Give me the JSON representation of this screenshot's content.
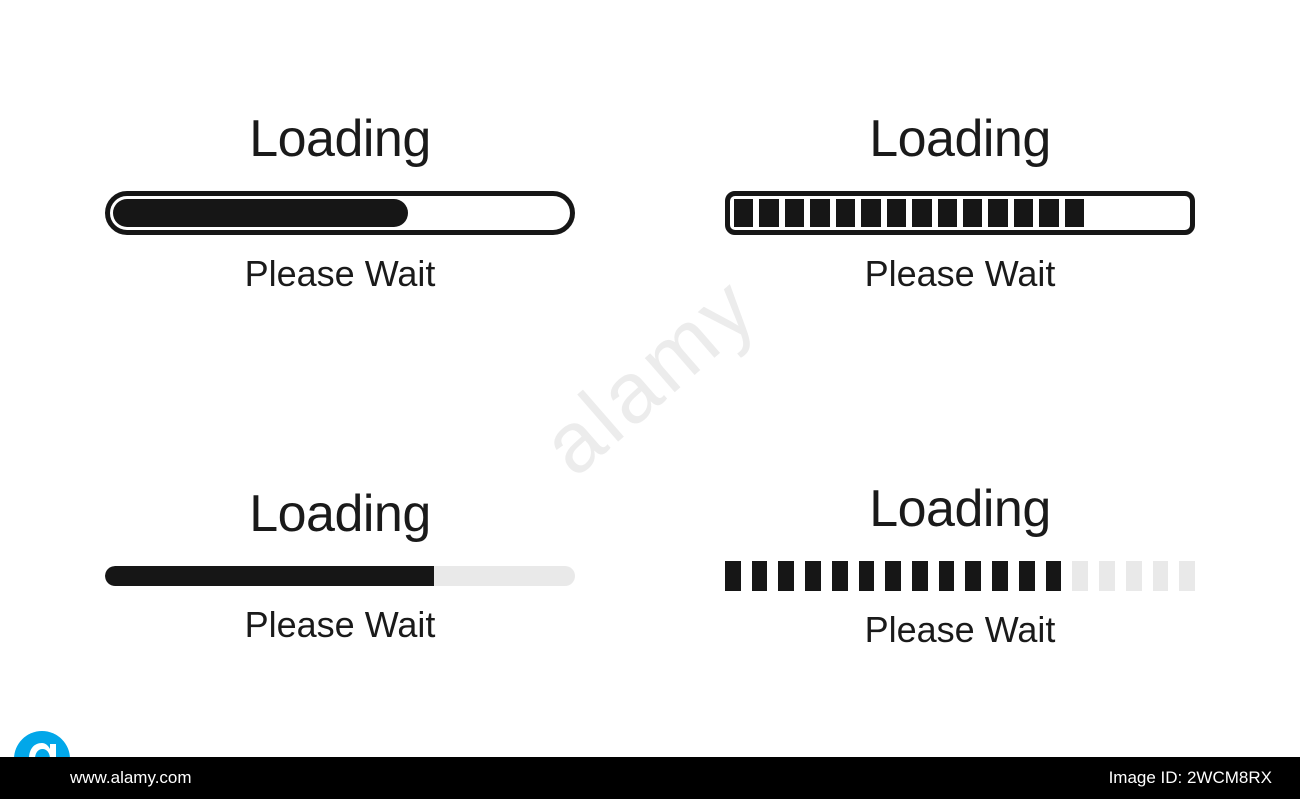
{
  "loaders": [
    {
      "title": "Loading",
      "subtitle": "Please Wait",
      "progress_percent": 65
    },
    {
      "title": "Loading",
      "subtitle": "Please Wait",
      "segments_on": 14,
      "segments_total": 18
    },
    {
      "title": "Loading",
      "subtitle": "Please Wait",
      "progress_percent": 70
    },
    {
      "title": "Loading",
      "subtitle": "Please Wait",
      "segments_on": 13,
      "segments_total": 18
    }
  ],
  "watermark": {
    "text": "alamy"
  },
  "footer": {
    "link_text": "www.alamy.com",
    "image_id": "Image ID: 2WCM8RX"
  },
  "colors": {
    "ink": "#161616",
    "track": "#e9e9e9",
    "bg": "#ffffff",
    "footer_bg": "#000000"
  }
}
